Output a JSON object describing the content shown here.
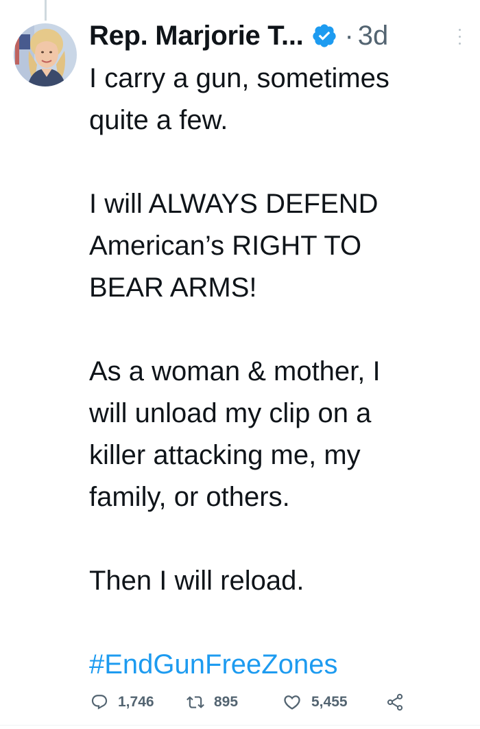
{
  "tweet": {
    "author_name": "Rep. Marjorie T...",
    "separator": "·",
    "timestamp": "3d",
    "paragraphs": [
      [
        "I carry a gun, sometimes",
        "quite a few."
      ],
      [
        "I will ALWAYS DEFEND",
        "American’s RIGHT TO",
        "BEAR ARMS!"
      ],
      [
        "As a woman & mother, I",
        "will unload my clip on a",
        "killer attacking me, my",
        "family, or others."
      ],
      [
        "Then I will reload."
      ]
    ],
    "hashtag": "#EndGunFreeZones"
  },
  "actions": {
    "reply_count": "1,746",
    "retweet_count": "895",
    "like_count": "5,455"
  },
  "icons": {
    "verified": "verified-badge-icon",
    "more": "more-options-icon",
    "reply": "reply-icon",
    "retweet": "retweet-icon",
    "like": "heart-icon",
    "share": "share-icon"
  },
  "colors": {
    "text": "#0f1419",
    "muted": "#536471",
    "accent": "#1d9bf0"
  }
}
